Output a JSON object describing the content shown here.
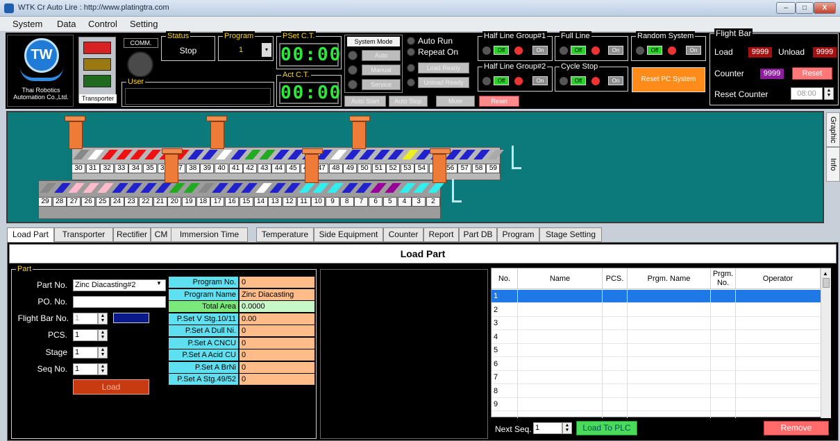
{
  "window": {
    "title": "WTK Cr Auto Lire : http://www.platingtra.com",
    "min": "–",
    "max": "□",
    "close": "X"
  },
  "menu": [
    "System",
    "Data",
    "Control",
    "Setting"
  ],
  "logo": {
    "initials": "TW",
    "company": "Thai Robotics Automation Co.,Ltd."
  },
  "traffic_light": {
    "label": "Transporter",
    "colors": [
      "#d62222",
      "#9a7a10",
      "#1e6a1e"
    ]
  },
  "comm": {
    "label": "COMM."
  },
  "user": {
    "label": "User",
    "value": ""
  },
  "status": {
    "label": "Status",
    "value": "Stop"
  },
  "program": {
    "label": "Program",
    "value": "1"
  },
  "pset_ct": {
    "label": "PSet C.T.",
    "value": "00:00"
  },
  "act_ct": {
    "label": "Act C.T.",
    "value": "00:00"
  },
  "system_mode": {
    "label": "System Mode",
    "buttons": [
      "Auto",
      "Manual",
      "Service"
    ]
  },
  "run_panel": {
    "auto_run": "Auto Run",
    "repeat_on": "Repeat On",
    "load_ready": "Load Ready",
    "unload_ready": "Unload Ready"
  },
  "bottom_buttons": {
    "auto_start": "Auto Start",
    "auto_stop": "Auto Stop",
    "mute": "Mute",
    "reset": "Reset"
  },
  "groups": {
    "half1": "Half Line Group#1",
    "half2": "Half Line Group#2",
    "full": "Full Line",
    "cycle": "Cycle Stop",
    "random": "Random System",
    "off": "Off",
    "on": "On",
    "reset_pc": "Reset PC System"
  },
  "flight_bar": {
    "label": "Flight Bar",
    "load_label": "Load",
    "load_value": "9999",
    "unload_label": "Unload",
    "unload_value": "9999",
    "counter_label": "Counter",
    "counter_value": "9999",
    "reset_label": "Reset",
    "reset_counter_label": "Reset Counter",
    "reset_counter_value": "08:00"
  },
  "side_tabs": {
    "graphic": "Graphic",
    "info": "Info"
  },
  "tanks": {
    "top": [
      "30",
      "31",
      "32",
      "33",
      "34",
      "35",
      "36",
      "37",
      "38",
      "39",
      "40",
      "41",
      "42",
      "43",
      "44",
      "45",
      "46",
      "47",
      "48",
      "49",
      "50",
      "51",
      "52",
      "53",
      "54",
      "55",
      "56",
      "57",
      "58",
      "59"
    ],
    "bottom": [
      "29",
      "28",
      "27",
      "26",
      "25",
      "24",
      "23",
      "22",
      "21",
      "20",
      "19",
      "18",
      "17",
      "16",
      "15",
      "14",
      "13",
      "12",
      "11",
      "10",
      "9",
      "8",
      "7",
      "6",
      "5",
      "4",
      "3",
      "2"
    ],
    "top_colors": [
      "#888",
      "#fff",
      "#e11",
      "#e11",
      "#e11",
      "#e11",
      "#e11",
      "#e11",
      "#22c",
      "#22c",
      "#fff",
      "#22c",
      "#2a2",
      "#2a2",
      "#22c",
      "#22c",
      "#22c",
      "#22c",
      "#fff",
      "#22c",
      "#22c",
      "#22c",
      "#22c",
      "#ee2",
      "#22c",
      "#22c",
      "#22c",
      "#22c",
      "#22c",
      "#aaa"
    ],
    "bottom_colors": [
      "#888",
      "#22c",
      "#fbc",
      "#fbc",
      "#fbc",
      "#22c",
      "#22c",
      "#22c",
      "#22c",
      "#2a2",
      "#2a2",
      "#888",
      "#22c",
      "#22c",
      "#22c",
      "#fff",
      "#22c",
      "#22c",
      "#3ee",
      "#3ee",
      "#3ee",
      "#22c",
      "#22c",
      "#909",
      "#909",
      "#3ee",
      "#3ee",
      "#3ee"
    ]
  },
  "tabs": [
    "Load Part",
    "Transporter",
    "Rectifier",
    "CM",
    "Immersion Time",
    "Temperature",
    "Side Equipment",
    "Counter",
    "Report",
    "Part DB",
    "Program",
    "Stage Setting"
  ],
  "load_part": {
    "title": "Load Part",
    "part_group": "Part",
    "fields": {
      "part_no_label": "Part No.",
      "part_no_value": "Zinc Diacasting#2",
      "po_label": "PO. No.",
      "po_value": "",
      "flight_bar_label": "Flight Bar No.",
      "flight_bar_value": "1",
      "pcs_label": "PCS.",
      "pcs_value": "1",
      "stage_label": "Stage",
      "stage_value": "1",
      "seq_label": "Seq No.",
      "seq_value": "1",
      "load_button": "Load"
    },
    "program_info": [
      {
        "label": "Program No.",
        "value": "0"
      },
      {
        "label": "Program Name",
        "value": "Zinc Diacasting"
      },
      {
        "label": "Total Area",
        "value": "0.0000"
      },
      {
        "label": "P.Set V Stg.10/11",
        "value": "0.00"
      },
      {
        "label": "P.Set A Dull Ni.",
        "value": "0"
      },
      {
        "label": "P.Set A CNCU",
        "value": "0"
      },
      {
        "label": "P.Set A Acid CU",
        "value": "0"
      },
      {
        "label": "P.Set A BrNi",
        "value": "0"
      },
      {
        "label": "P.Set A Stg.49/52",
        "value": "0"
      }
    ]
  },
  "grid": {
    "columns": [
      "No.",
      "Name",
      "PCS.",
      "Prgm. Name",
      "Prgm. No.",
      "Operator"
    ],
    "rows": [
      "1",
      "2",
      "3",
      "4",
      "5",
      "6",
      "7",
      "8",
      "9"
    ],
    "next_seq_label": "Next Seq.",
    "next_seq_value": "1",
    "load_plc": "Load To PLC",
    "remove": "Remove"
  }
}
